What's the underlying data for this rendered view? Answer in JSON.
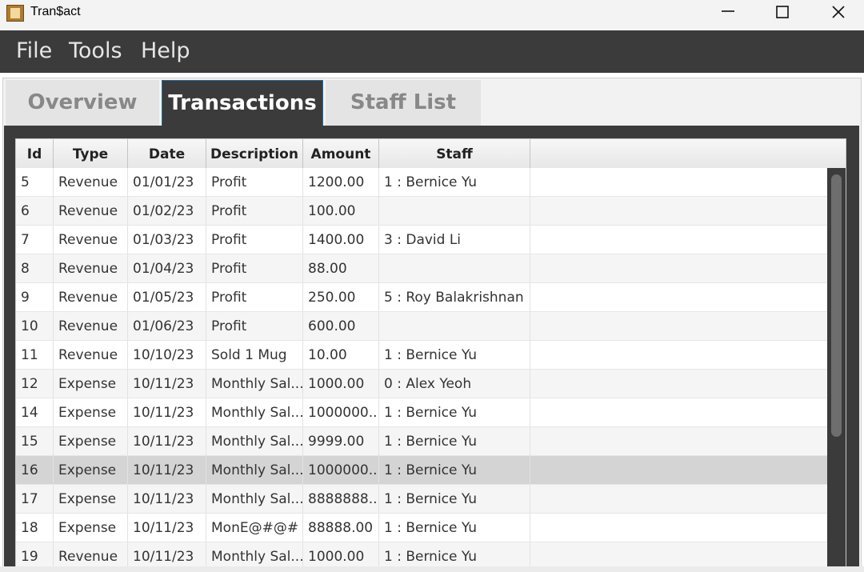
{
  "window": {
    "title": "Tran$act"
  },
  "menu": {
    "file": "File",
    "tools": "Tools",
    "help": "Help"
  },
  "tabs": [
    {
      "label": "Overview"
    },
    {
      "label": "Transactions"
    },
    {
      "label": "Staff List"
    }
  ],
  "table": {
    "columns": [
      "Id",
      "Type",
      "Date",
      "Description",
      "Amount",
      "Staff"
    ],
    "rows": [
      {
        "id": "5",
        "type": "Revenue",
        "date": "01/01/23",
        "desc": "Profit",
        "amount": "1200.00",
        "staff": "1 : Bernice Yu"
      },
      {
        "id": "6",
        "type": "Revenue",
        "date": "01/02/23",
        "desc": "Profit",
        "amount": "100.00",
        "staff": ""
      },
      {
        "id": "7",
        "type": "Revenue",
        "date": "01/03/23",
        "desc": "Profit",
        "amount": "1400.00",
        "staff": "3 : David Li"
      },
      {
        "id": "8",
        "type": "Revenue",
        "date": "01/04/23",
        "desc": "Profit",
        "amount": "88.00",
        "staff": ""
      },
      {
        "id": "9",
        "type": "Revenue",
        "date": "01/05/23",
        "desc": "Profit",
        "amount": "250.00",
        "staff": "5 : Roy Balakrishnan"
      },
      {
        "id": "10",
        "type": "Revenue",
        "date": "01/06/23",
        "desc": "Profit",
        "amount": "600.00",
        "staff": ""
      },
      {
        "id": "11",
        "type": "Revenue",
        "date": "10/10/23",
        "desc": "Sold 1 Mug",
        "amount": "10.00",
        "staff": "1 : Bernice Yu"
      },
      {
        "id": "12",
        "type": "Expense",
        "date": "10/11/23",
        "desc": "Monthly Sal...",
        "amount": "1000.00",
        "staff": "0 : Alex Yeoh"
      },
      {
        "id": "14",
        "type": "Expense",
        "date": "10/11/23",
        "desc": "Monthly Sal...",
        "amount": "1000000...",
        "staff": "1 : Bernice Yu"
      },
      {
        "id": "15",
        "type": "Expense",
        "date": "10/11/23",
        "desc": "Monthly Sal...",
        "amount": "9999.00",
        "staff": "1 : Bernice Yu"
      },
      {
        "id": "16",
        "type": "Expense",
        "date": "10/11/23",
        "desc": "Monthly Sal...",
        "amount": "1000000...",
        "staff": "1 : Bernice Yu"
      },
      {
        "id": "17",
        "type": "Expense",
        "date": "10/11/23",
        "desc": "Monthly Sal...",
        "amount": "8888888...",
        "staff": "1 : Bernice Yu"
      },
      {
        "id": "18",
        "type": "Expense",
        "date": "10/11/23",
        "desc": "MonE@#@#",
        "amount": "88888.00",
        "staff": "1 : Bernice Yu"
      },
      {
        "id": "19",
        "type": "Revenue",
        "date": "10/11/23",
        "desc": "Monthly Sal...",
        "amount": "1000.00",
        "staff": "1 : Bernice Yu"
      }
    ],
    "selected_id": "16"
  },
  "colors": {
    "menubar_bg": "#3b3b3b",
    "active_tab_bg": "#3b3b3b",
    "selected_row_bg": "#d4d4d4"
  },
  "icons": {
    "app": "contact-book-icon",
    "minimize": "minimize-icon",
    "maximize": "maximize-icon",
    "close": "close-icon"
  }
}
